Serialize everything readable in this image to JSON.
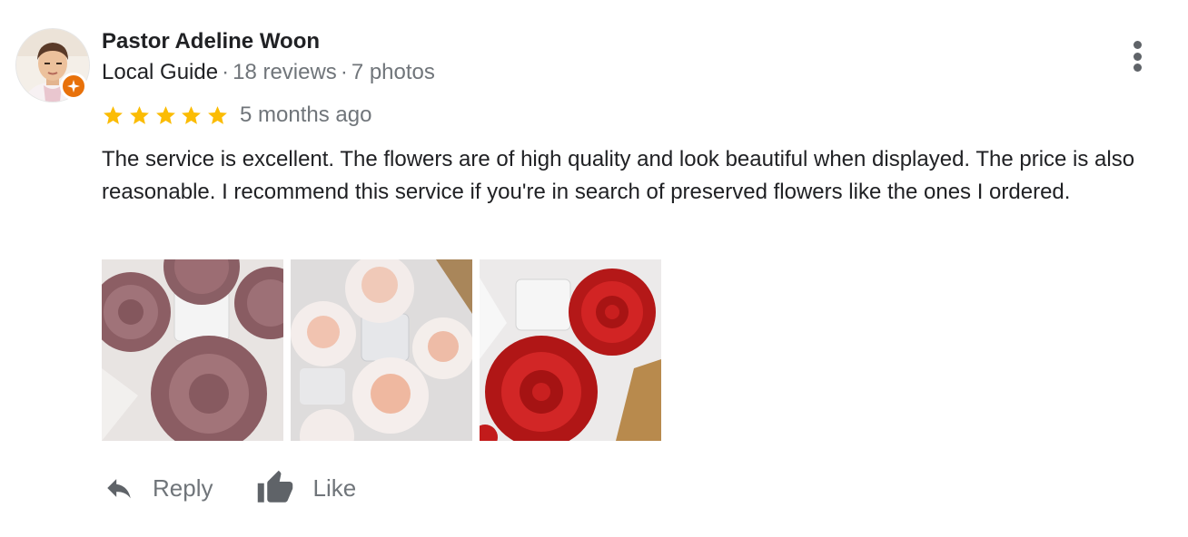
{
  "reviewer": {
    "name": "Pastor Adeline Woon",
    "badge": "Local Guide",
    "reviews": "18 reviews",
    "photos": "7 photos",
    "separator": "·",
    "badge_color": "#e8710a"
  },
  "rating": {
    "stars": 5,
    "max": 5,
    "time": "5 months ago",
    "star_color": "#fbbc04"
  },
  "review": {
    "text": "The service is excellent. The flowers are of high quality and look beautiful when displayed. The price is also reasonable. I recommend this service if you're in search of preserved flowers like the ones I ordered."
  },
  "photos": [
    {
      "subject": "mauve preserved roses in white tray"
    },
    {
      "subject": "pale peach preserved roses in white tray"
    },
    {
      "subject": "red preserved roses in white tray"
    }
  ],
  "actions": {
    "reply": "Reply",
    "like": "Like"
  },
  "icons": {
    "more": "more-vert-icon",
    "reply": "reply-arrow-icon",
    "like": "thumbs-up-icon",
    "star": "star-icon",
    "guide": "local-guide-badge-icon"
  }
}
